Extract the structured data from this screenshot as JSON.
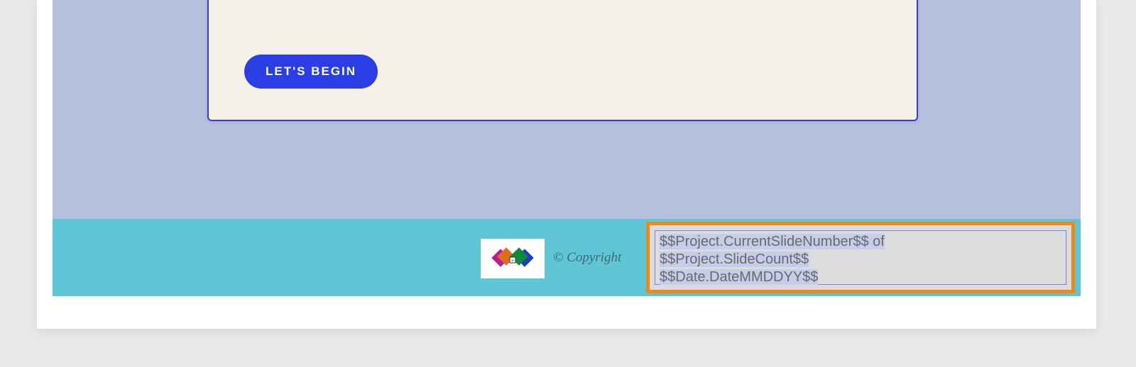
{
  "content": {
    "begin_button_label": "LET'S BEGIN"
  },
  "footer": {
    "copyright_text": "© Copyright",
    "highlight": {
      "line1_var1": "$$Project.CurrentSlideNumber$$",
      "line1_of": " of ",
      "line2_var": "$$Project.SlideCount$$",
      "line3_var": "$$Date.DateMMDDYY$$"
    }
  }
}
